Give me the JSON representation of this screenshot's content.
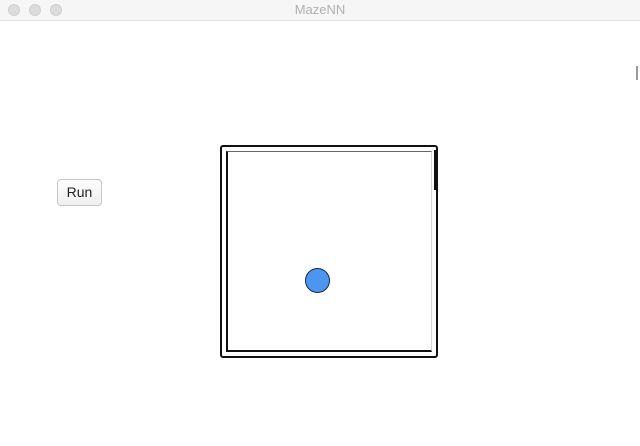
{
  "window": {
    "title": "MazeNN"
  },
  "controls": {
    "run_label": "Run"
  },
  "maze": {
    "agent_color": "#4a96f0"
  }
}
